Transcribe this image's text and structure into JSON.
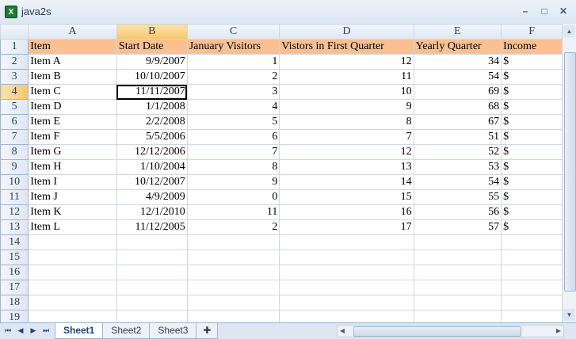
{
  "window": {
    "title": "java2s",
    "app_icon_letter": "X",
    "minimize": "–",
    "maximize": "□",
    "close": "✕"
  },
  "columns": [
    "A",
    "B",
    "C",
    "D",
    "E",
    "F"
  ],
  "selected_column": "B",
  "header": [
    "Item",
    "Start Date",
    "January Visitors",
    "Vistors in First Quarter",
    "Yearly Quarter",
    "Income"
  ],
  "rows": [
    [
      "Item A",
      "9/9/2007",
      "1",
      "12",
      "34",
      "$"
    ],
    [
      "Item B",
      "10/10/2007",
      "2",
      "11",
      "54",
      "$"
    ],
    [
      "Item C",
      "11/11/2007",
      "3",
      "10",
      "69",
      "$"
    ],
    [
      "Item D",
      "1/1/2008",
      "4",
      "9",
      "68",
      "$"
    ],
    [
      "Item E",
      "2/2/2008",
      "5",
      "8",
      "67",
      "$"
    ],
    [
      "Item F",
      "5/5/2006",
      "6",
      "7",
      "51",
      "$"
    ],
    [
      "Item G",
      "12/12/2006",
      "7",
      "12",
      "52",
      "$"
    ],
    [
      "Item H",
      "1/10/2004",
      "8",
      "13",
      "53",
      "$"
    ],
    [
      "Item I",
      "10/12/2007",
      "9",
      "14",
      "54",
      "$"
    ],
    [
      "Item J",
      "4/9/2009",
      "0",
      "15",
      "55",
      "$"
    ],
    [
      "Item K",
      "12/1/2010",
      "11",
      "16",
      "56",
      "$"
    ],
    [
      "Item L",
      "11/12/2005",
      "2",
      "17",
      "57",
      "$"
    ]
  ],
  "row_numbers": [
    "1",
    "2",
    "3",
    "4",
    "5",
    "6",
    "7",
    "8",
    "9",
    "10",
    "11",
    "12",
    "13",
    "14",
    "15",
    "16",
    "17",
    "18",
    "19"
  ],
  "selected_row": "4",
  "active_cell": "B4",
  "sheets": [
    "Sheet1",
    "Sheet2",
    "Sheet3"
  ],
  "active_sheet": "Sheet1",
  "colors": {
    "header_fill": "#fac090",
    "selection": "#f7c66c"
  }
}
